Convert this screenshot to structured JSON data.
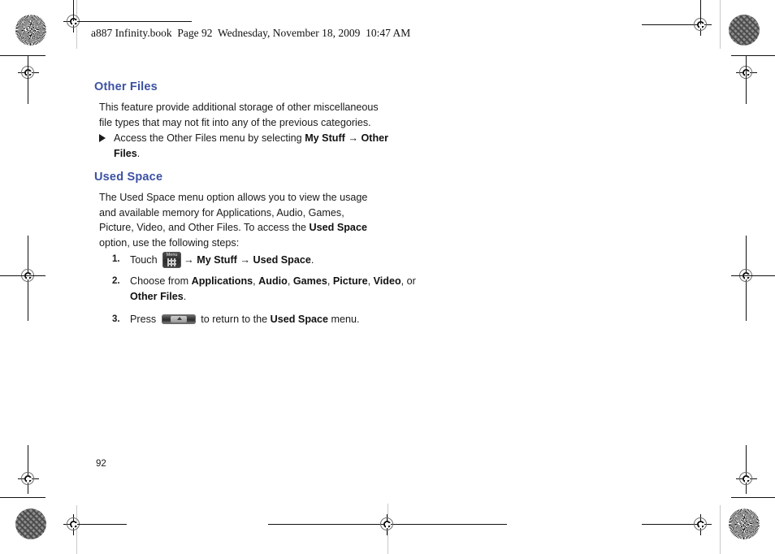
{
  "running_header": "a887 Infinity.book  Page 92  Wednesday, November 18, 2009  10:47 AM",
  "page_number": "92",
  "colors": {
    "heading_blue": "#3c51a3",
    "body_text": "#1a1a1a",
    "registration_mark": "#111111"
  },
  "sections": [
    {
      "id": "other-files",
      "heading": "Other Files",
      "paragraph": "This feature provide additional storage of other miscellaneous file types that may not fit into any of the previous categories.",
      "bullet": {
        "lead": "Access the Other Files menu by selecting ",
        "bold_1": "My Stuff",
        "arrow": "→",
        "bold_2": "Other Files",
        "tail": "."
      }
    },
    {
      "id": "used-space",
      "heading": "Used Space",
      "paragraph_1": "The Used Space menu option allows you to view the usage and available memory for Applications, Audio, Games, Picture, Video, and Other Files. To access the ",
      "paragraph_bold": "Used Space",
      "paragraph_2": " option, use the following steps:",
      "steps": [
        {
          "number": "1.",
          "lead": "Touch ",
          "icon": "menu-key-icon",
          "arrow": "→",
          "bold_1": "My Stuff",
          "bold_2": "Used Space",
          "tail": "."
        },
        {
          "number": "2.",
          "lead": "Choose from ",
          "options": [
            "Applications",
            "Audio",
            "Games",
            "Picture",
            "Video"
          ],
          "conjunction": ", or ",
          "last_option": "Other Files",
          "tail": "."
        },
        {
          "number": "3.",
          "lead": "Press ",
          "icon": "back-key-icon",
          "mid": " to return to the ",
          "bold_1": "Used Space",
          "tail": " menu."
        }
      ]
    }
  ],
  "print_marks": {
    "target_icon": "registration-target-icon",
    "halftone_burst_icon": "halftone-starburst-icon",
    "halftone_maze_icon": "halftone-maze-icon"
  }
}
